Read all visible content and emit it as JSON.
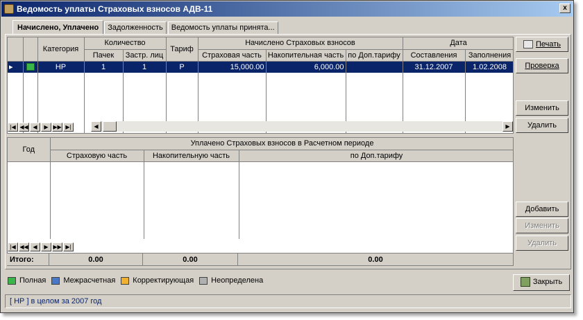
{
  "window": {
    "title": "Ведомость уплаты Страховых взносов АДВ-11",
    "close_glyph": "x"
  },
  "tabs": [
    {
      "label": "Начислено, Уплачено",
      "active": true
    },
    {
      "label": "Задолженность",
      "active": false
    },
    {
      "label": "Ведомость уплаты принята...",
      "active": false
    }
  ],
  "grid_top": {
    "headers": {
      "kategoria": "Категория",
      "kolichestvo": "Количество",
      "pachek": "Пачек",
      "zastr": "Застр. лиц",
      "tarif": "Тариф",
      "nachisleno": "Начислено Страховых взносов",
      "strah": "Страховая часть",
      "nakop": "Накопительная часть",
      "dop": "по Доп.тарифу",
      "data": "Дата",
      "sostavlenia": "Составления",
      "zapolnenia": "Заполнения"
    },
    "rows": [
      {
        "icon": "green-record-icon",
        "kategoria": "НР",
        "pachek": "1",
        "zastr": "1",
        "tarif": "Р",
        "strah": "15,000.00",
        "nakop": "6,000.00",
        "dop": "",
        "sostavlenia": "31.12.2007",
        "zapolnenia": "1.02.2008"
      }
    ]
  },
  "grid_bottom": {
    "headers": {
      "god": "Год",
      "uplacheno": "Уплачено Страховых взносов в Расчетном периоде",
      "strah": "Страховую часть",
      "nakop": "Накопительную часть",
      "dop": "по Доп.тарифу"
    },
    "totals": {
      "label": "Итого:",
      "strah": "0.00",
      "nakop": "0.00",
      "dop": "0.00"
    }
  },
  "buttons": {
    "print": "Печать",
    "check": "Проверка",
    "edit_top": "Изменить",
    "delete_top": "Удалить",
    "add": "Добавить",
    "edit_bottom": "Изменить",
    "delete_bottom": "Удалить",
    "close": "Закрыть"
  },
  "navigator": {
    "first": "|◀",
    "prev_page": "◀◀",
    "prev": "◀",
    "next": "▶",
    "next_page": "▶▶",
    "last": "▶|"
  },
  "legend": [
    {
      "label": "Полная",
      "color": "#39b54a"
    },
    {
      "label": "Межрасчетная",
      "color": "#4a78c8"
    },
    {
      "label": "Корректирующая",
      "color": "#f0b030"
    },
    {
      "label": "Неопределена",
      "color": "#b0b0b0"
    }
  ],
  "status": {
    "text": "[ НР ] в целом за 2007 год"
  }
}
